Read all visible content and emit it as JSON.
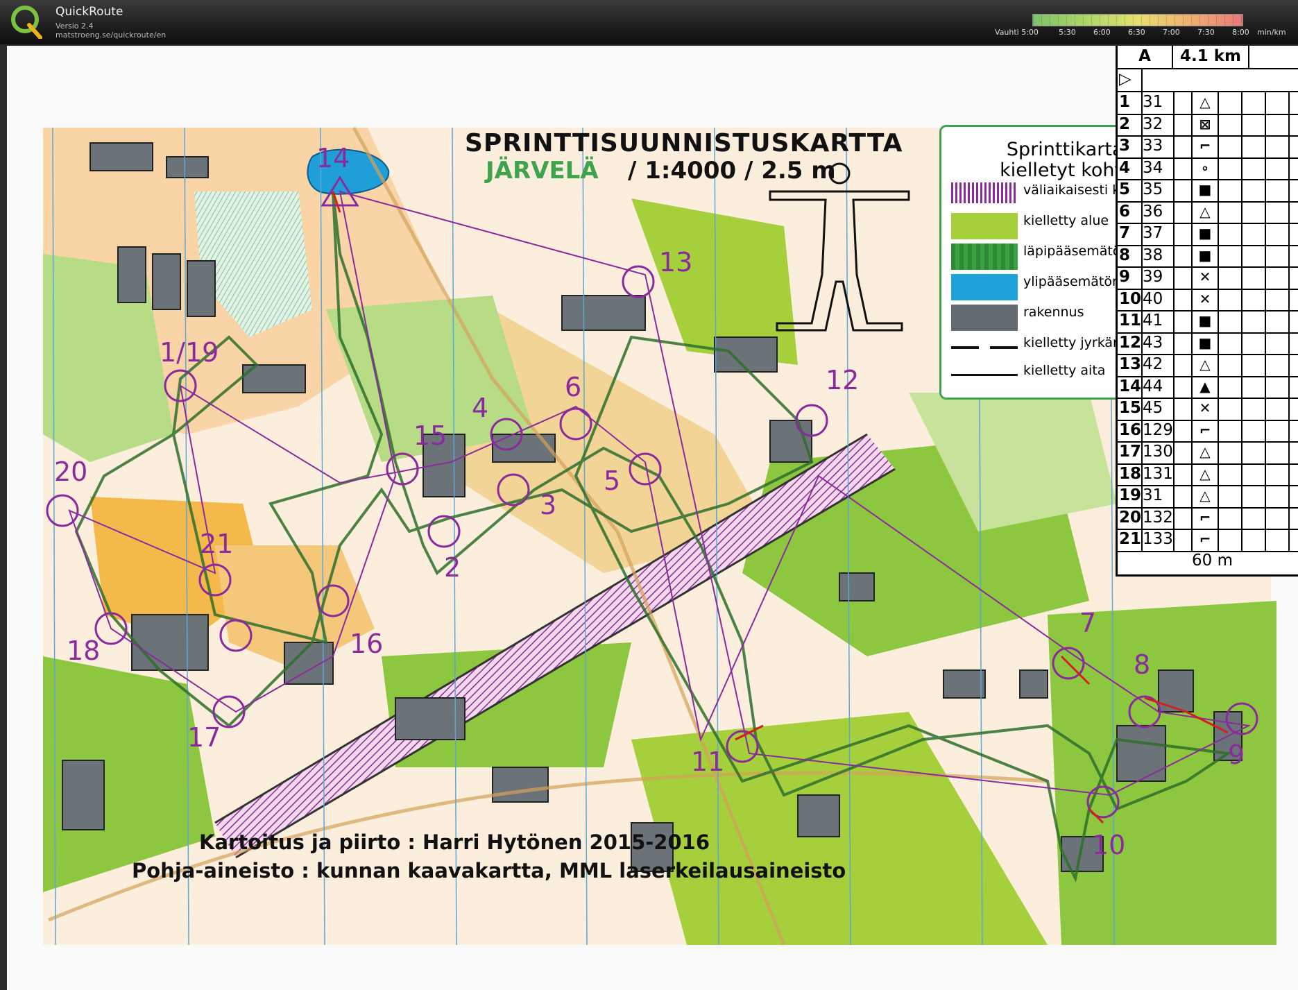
{
  "app": {
    "name": "QuickRoute",
    "version": "Versio 2.4",
    "url": "matstroeng.se/quickroute/en"
  },
  "pace_legend": {
    "label": "Vauhti 5:00",
    "ticks": [
      "5:30",
      "6:00",
      "6:30",
      "7:00",
      "7:30",
      "8:00"
    ],
    "unit": "min/km",
    "colors": [
      "#7ec36a",
      "#b8d96a",
      "#e6e070",
      "#f0b070",
      "#e87a7a"
    ]
  },
  "map": {
    "title": "SPRINTTISUUNNISTUSKARTTA",
    "name": "JÄRVELÄ",
    "scale": "/ 1:4000 / 2.5 m",
    "credit_mapping": "Kartoitus ja piirto : Harri Hytönen 2015-2016",
    "credit_base": "Pohja-aineisto : kunnan kaavakartta, MML laserkeilausaineisto",
    "colors": {
      "open": "#f6c98f",
      "green": "#8dc63f",
      "dark_green": "#3b8a3a",
      "building": "#6b7378",
      "water": "#1f9ed8",
      "course": "#8a2a9c",
      "track": "#2e6e2a",
      "route": "#d12020"
    },
    "controls": [
      "1/19",
      "2",
      "3",
      "4",
      "5",
      "6",
      "7",
      "8",
      "9",
      "10",
      "11",
      "12",
      "13",
      "14",
      "15",
      "16",
      "17",
      "18",
      "20",
      "21"
    ]
  },
  "legend": {
    "title_line1": "Sprinttikartalla",
    "title_line2": "kielletyt kohteet",
    "items": [
      {
        "label": "väliaikaisesti kielletty alue",
        "swatch": "hatch"
      },
      {
        "label": "kielletty alue",
        "swatch": "#a6cf3c"
      },
      {
        "label": "läpipääsemätön kasvillisuus",
        "swatch": "#2e8a37"
      },
      {
        "label": "ylipääsemätön vesialue",
        "swatch": "#1fa3dc"
      },
      {
        "label": "rakennus",
        "swatch": "#636b70"
      },
      {
        "label": "kielletty jyrkänne",
        "swatch": "cliff"
      },
      {
        "label": "kielletty aita",
        "swatch": "fence"
      }
    ]
  },
  "control_descriptions": {
    "class": "A",
    "length": "4.1 km",
    "rows": [
      {
        "num": "1",
        "code": "31",
        "symbol": "△"
      },
      {
        "num": "2",
        "code": "32",
        "symbol": "⊠"
      },
      {
        "num": "3",
        "code": "33",
        "symbol": "⌐"
      },
      {
        "num": "4",
        "code": "34",
        "symbol": "∘"
      },
      {
        "num": "5",
        "code": "35",
        "symbol": "■"
      },
      {
        "num": "6",
        "code": "36",
        "symbol": "△"
      },
      {
        "num": "7",
        "code": "37",
        "symbol": "■"
      },
      {
        "num": "8",
        "code": "38",
        "symbol": "■"
      },
      {
        "num": "9",
        "code": "39",
        "symbol": "✕"
      },
      {
        "num": "10",
        "code": "40",
        "symbol": "✕"
      },
      {
        "num": "11",
        "code": "41",
        "symbol": "■"
      },
      {
        "num": "12",
        "code": "43",
        "symbol": "■"
      },
      {
        "num": "13",
        "code": "42",
        "symbol": "△"
      },
      {
        "num": "14",
        "code": "44",
        "symbol": "▲"
      },
      {
        "num": "15",
        "code": "45",
        "symbol": "✕"
      },
      {
        "num": "16",
        "code": "129",
        "symbol": "⌐"
      },
      {
        "num": "17",
        "code": "130",
        "symbol": "△"
      },
      {
        "num": "18",
        "code": "131",
        "symbol": "△"
      },
      {
        "num": "19",
        "code": "31",
        "symbol": "△"
      },
      {
        "num": "20",
        "code": "132",
        "symbol": "⌐"
      },
      {
        "num": "21",
        "code": "133",
        "symbol": "⌐"
      }
    ],
    "footer": "60 m"
  }
}
